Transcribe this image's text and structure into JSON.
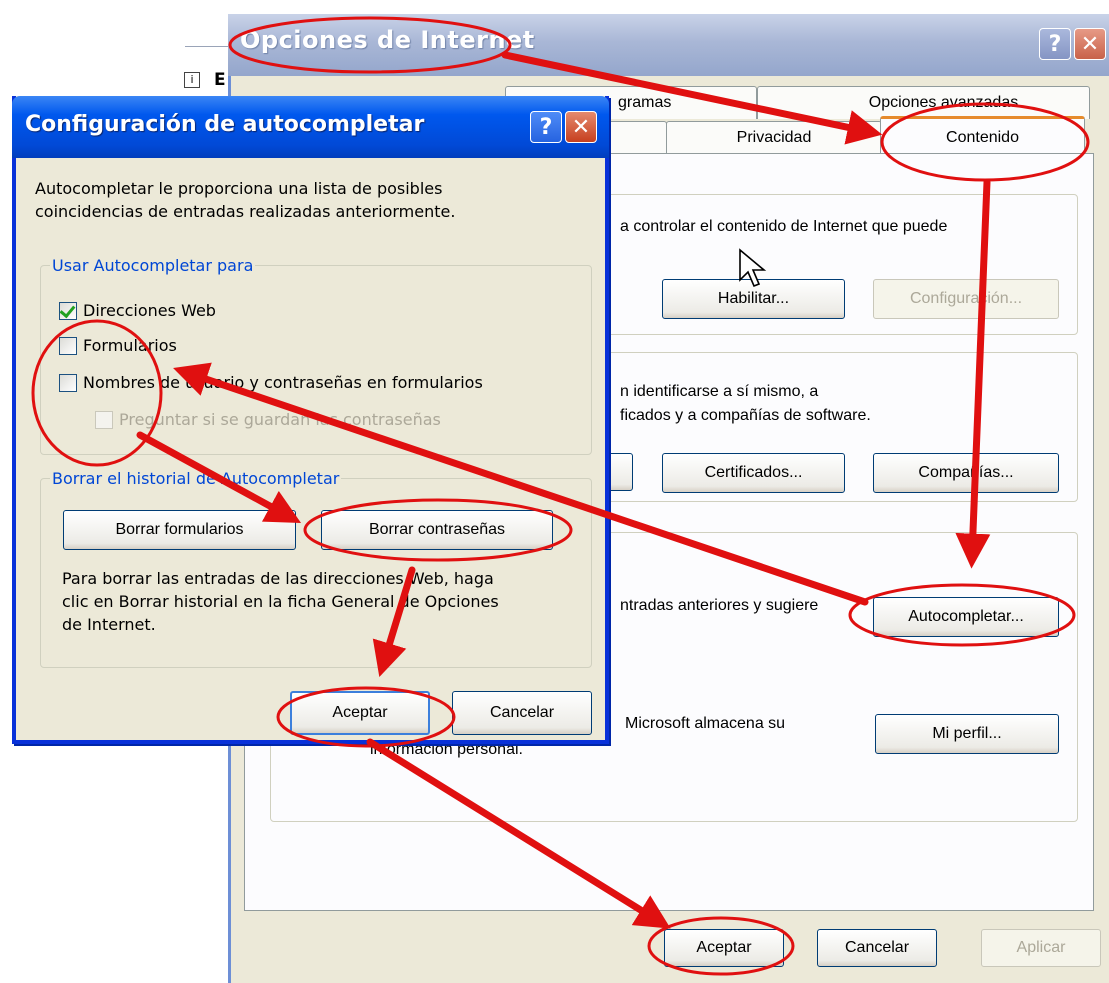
{
  "left_fragment": {
    "info_glyph": "i",
    "letter": "E"
  },
  "internet_options": {
    "title": "Opciones de Internet",
    "tabs": {
      "programas_partial": "gramas",
      "avanzadas": "Opciones avanzadas",
      "privacidad": "Privacidad",
      "contenido": "Contenido"
    },
    "content_advisor": {
      "text": "a controlar el contenido de Internet que puede",
      "enable_button": "Habilitar...",
      "settings_button": "Configuración..."
    },
    "certificates": {
      "text_line1": "n identificarse a sí mismo, a",
      "text_line2": "ficados y a compañías de software.",
      "certificates_button": "Certificados...",
      "publishers_button": "Compañías..."
    },
    "personal_info": {
      "autocomplete_text": "ntradas anteriores y sugiere",
      "autocomplete_button": "Autocompletar...",
      "profile_text_line1": "Microsoft almacena su",
      "profile_text_line2": "información personal.",
      "profile_button": "Mi perfil..."
    },
    "buttons": {
      "ok": "Aceptar",
      "cancel": "Cancelar",
      "apply": "Aplicar"
    }
  },
  "autocomplete_dialog": {
    "title": "Configuración de autocompletar",
    "description_line1": "Autocompletar le proporciona una lista de posibles",
    "description_line2": "coincidencias de entradas realizadas anteriormente.",
    "use_group": {
      "legend": "Usar Autocompletar para",
      "web_addresses": {
        "label": "Direcciones Web",
        "checked": true
      },
      "forms": {
        "label": "Formularios",
        "checked": false
      },
      "usernames": {
        "label": "Nombres de usuario y contraseñas en formularios",
        "checked": false
      },
      "ask_save": {
        "label": "Preguntar si se guardan las contraseñas",
        "checked": false,
        "enabled": false
      }
    },
    "clear_group": {
      "legend": "Borrar el historial de Autocompletar",
      "clear_forms_button": "Borrar formularios",
      "clear_passwords_button": "Borrar contraseñas",
      "note_line1": "Para borrar las entradas de las direcciones Web, haga",
      "note_line2": "clic en Borrar historial en la ficha General de Opciones",
      "note_line3": "de Internet."
    },
    "buttons": {
      "ok": "Aceptar",
      "cancel": "Cancelar"
    },
    "title_help": "?",
    "title_close": "✕"
  },
  "annotation_color": "#e01010"
}
